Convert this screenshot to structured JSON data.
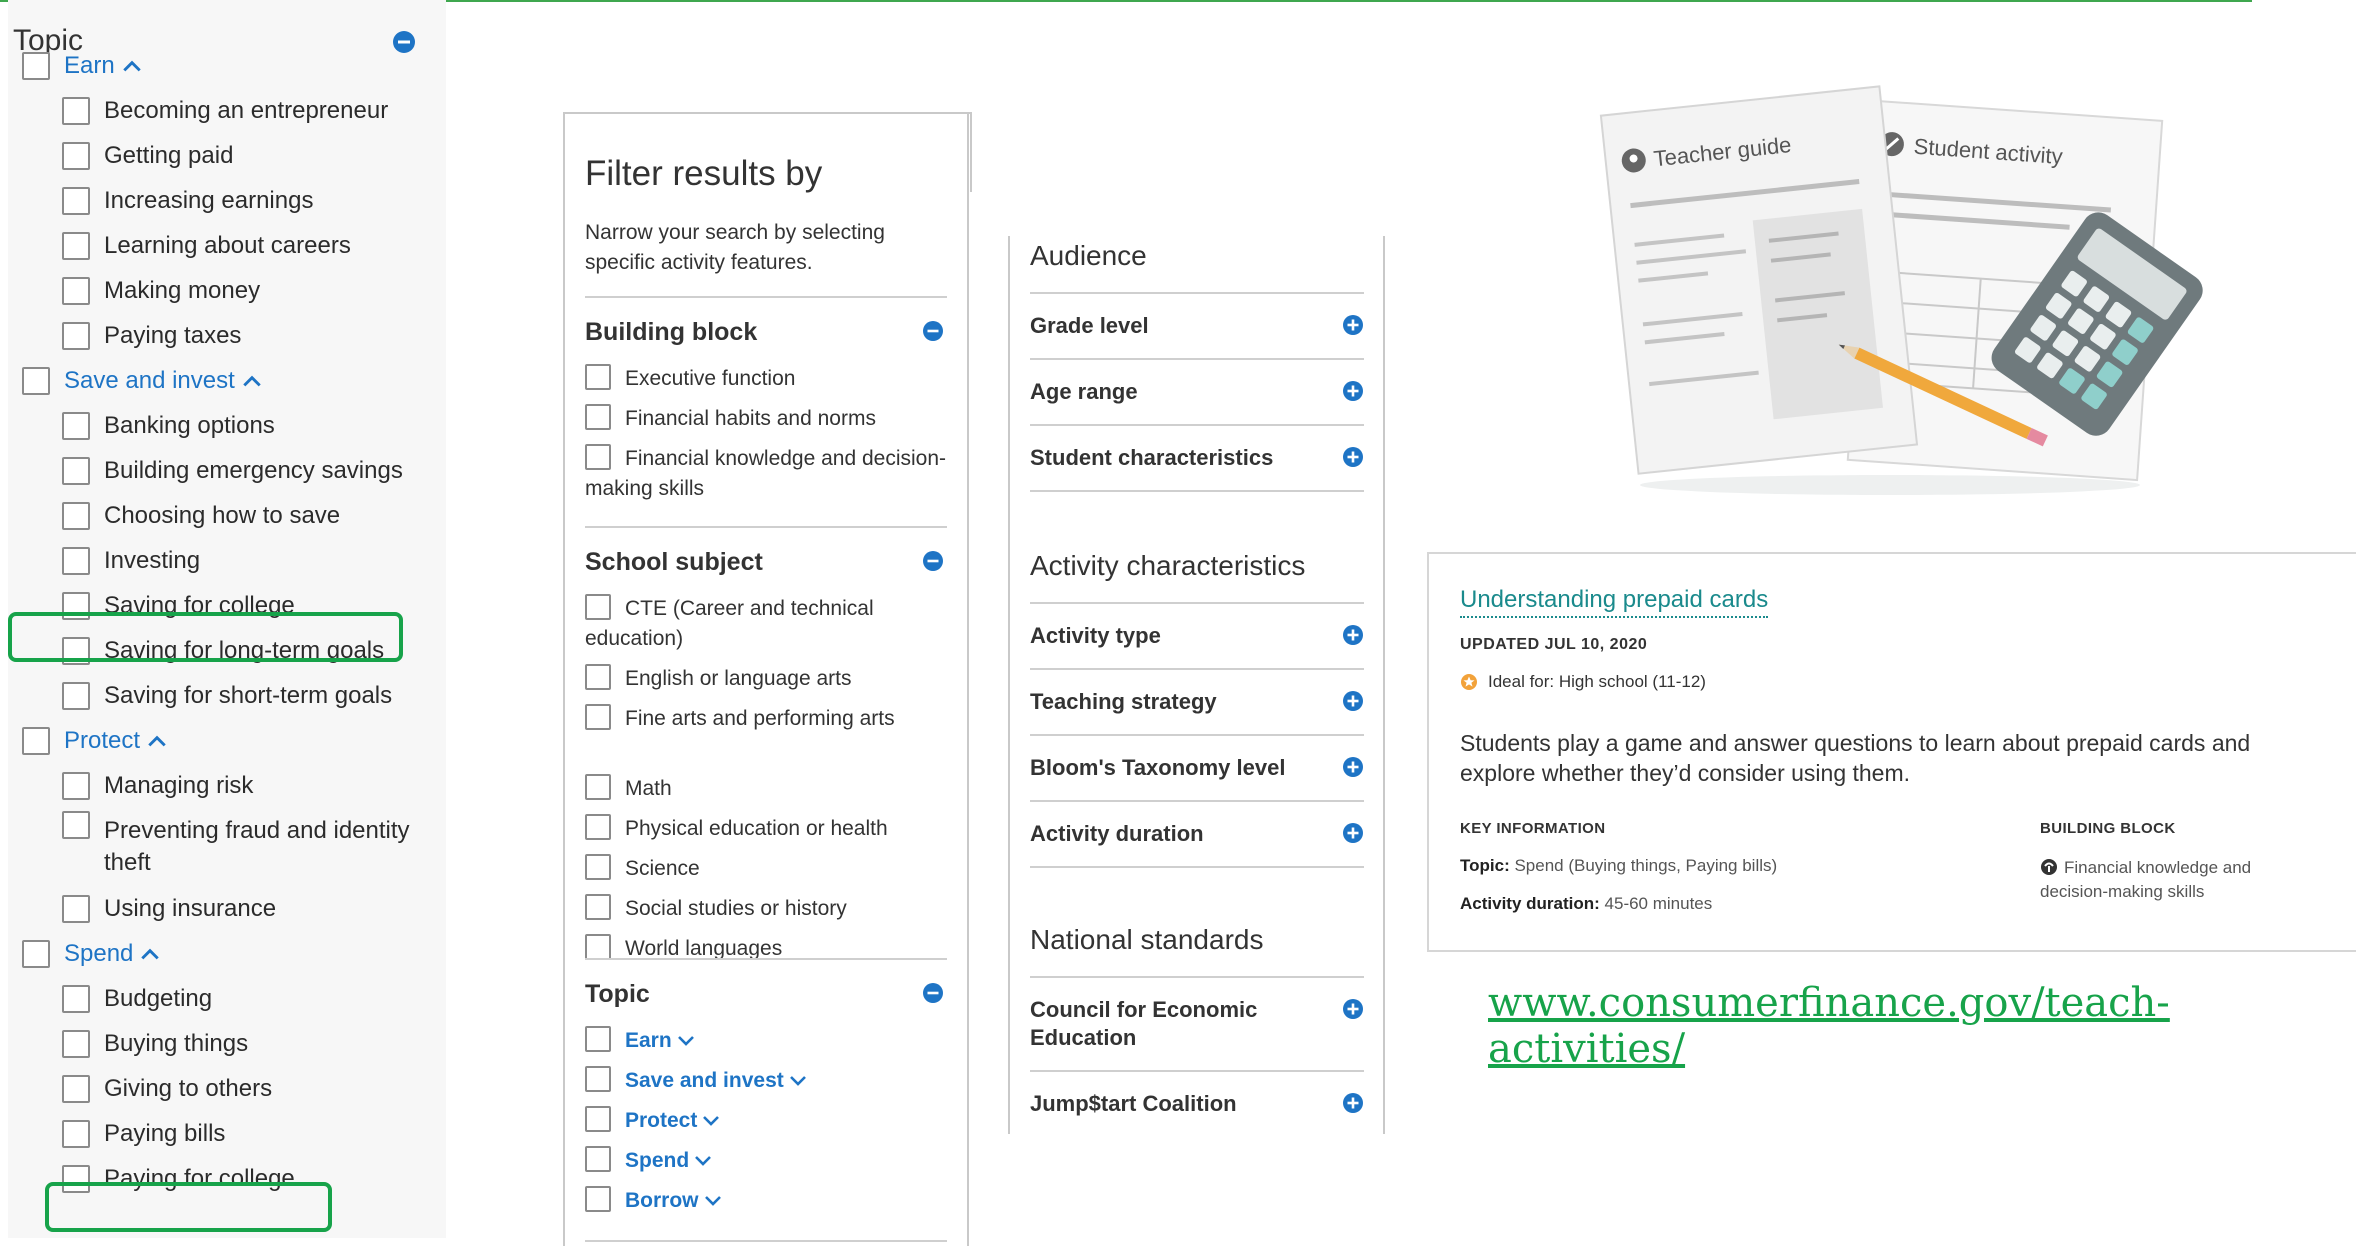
{
  "colors": {
    "accent_blue": "#1e74c5",
    "highlight_green": "#17a34a",
    "card_link_teal": "#1a8a8c"
  },
  "left_panel": {
    "title": "Topic",
    "groups": [
      {
        "label": "Earn",
        "items": [
          "Becoming an entrepreneur",
          "Getting paid",
          "Increasing earnings",
          "Learning about careers",
          "Making money",
          "Paying taxes"
        ]
      },
      {
        "label": "Save and invest",
        "items": [
          "Banking options",
          "Building emergency savings",
          "Choosing how to save",
          "Investing",
          "Saving for college",
          "Saving for long-term goals",
          "Saving for short-term goals"
        ]
      },
      {
        "label": "Protect",
        "items": [
          "Managing risk",
          "Preventing fraud and identity theft",
          "Using insurance"
        ]
      },
      {
        "label": "Spend",
        "items": [
          "Budgeting",
          "Buying things",
          "Giving to others",
          "Paying bills",
          "Paying for college"
        ]
      }
    ]
  },
  "filter_panel": {
    "title": "Filter results by",
    "description": "Narrow your search by selecting specific activity features.",
    "sections": [
      {
        "title": "Building block",
        "items": [
          "Executive function",
          "Financial habits and norms",
          "Financial knowledge and decision-making skills"
        ]
      },
      {
        "title": "School subject",
        "items": [
          "CTE (Career and technical education)",
          "English or language arts",
          "Fine arts and performing arts",
          "Math",
          "Physical education or health",
          "Science",
          "Social studies or history",
          "World languages"
        ]
      },
      {
        "title": "Topic",
        "items": [
          "Earn",
          "Save and invest",
          "Protect",
          "Spend",
          "Borrow"
        ]
      }
    ]
  },
  "audience_panel": {
    "groups": [
      {
        "heading": "Audience",
        "items": [
          "Grade level",
          "Age range",
          "Student characteristics"
        ]
      },
      {
        "heading": "Activity characteristics",
        "items": [
          "Activity type",
          "Teaching strategy",
          "Bloom's Taxonomy level",
          "Activity duration"
        ]
      },
      {
        "heading": "National standards",
        "items": [
          "Council for Economic Education",
          "Jump$tart Coalition"
        ]
      }
    ]
  },
  "illustration": {
    "teacher_guide": "Teacher guide",
    "student_activity": "Student activity"
  },
  "card": {
    "title": "Understanding prepaid cards",
    "updated": "UPDATED JUL 10, 2020",
    "ideal_for": "Ideal for: High school (11-12)",
    "description": "Students play a game and answer questions to learn about prepaid cards and explore whether they’d consider using them.",
    "key_info_heading": "KEY INFORMATION",
    "topic_label": "Topic:",
    "topic_value": "Spend (Buying things, Paying bills)",
    "duration_label": "Activity duration:",
    "duration_value": "45-60 minutes",
    "building_block_heading": "BUILDING BLOCK",
    "building_block_value": "Financial knowledge and decision-making skills"
  },
  "url": "www.consumerfinance.gov/teach-activities/"
}
